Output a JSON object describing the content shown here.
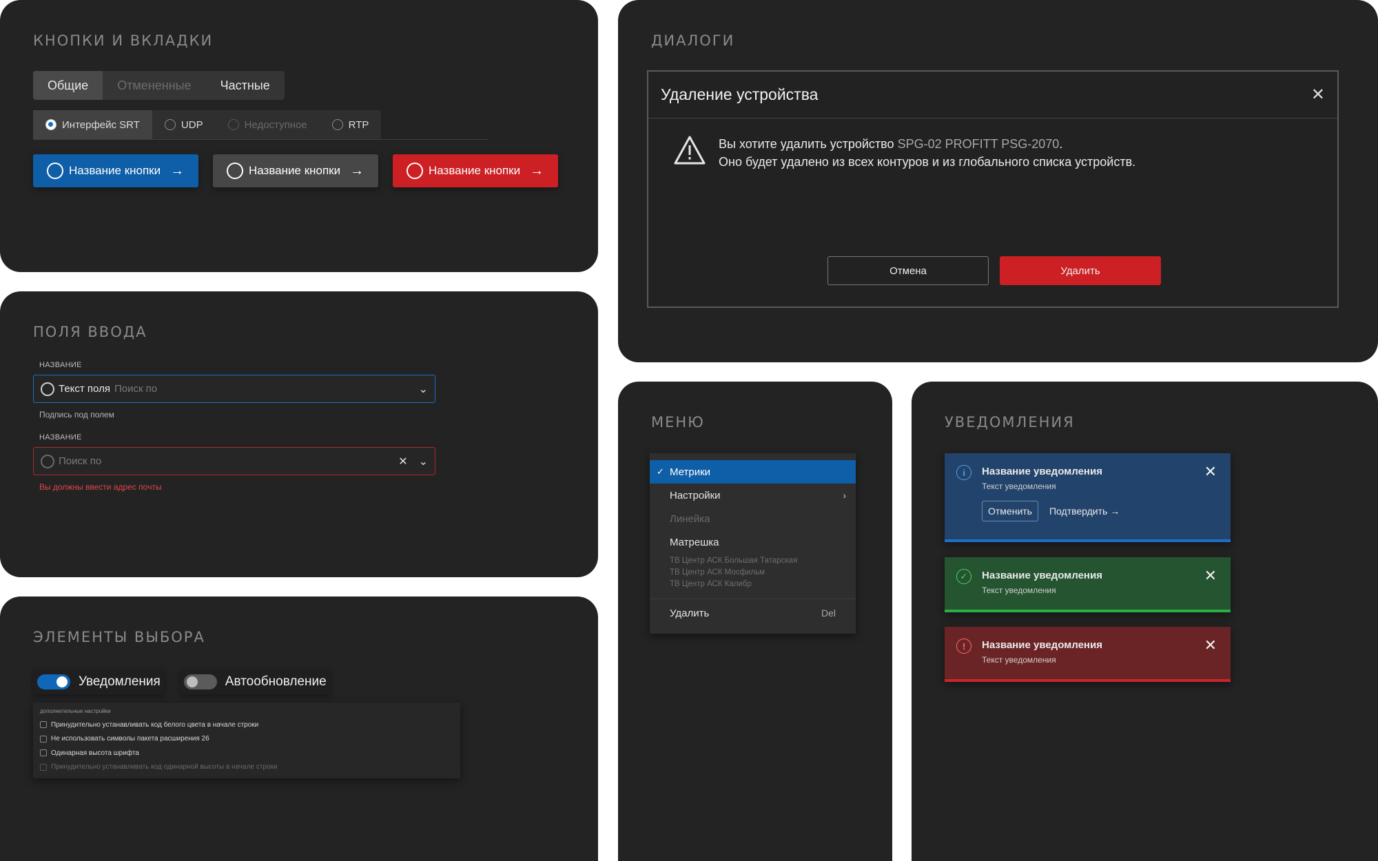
{
  "buttons_panel": {
    "title": "КНОПКИ И ВКЛАДКИ",
    "tabs": [
      {
        "label": "Общие",
        "state": "active"
      },
      {
        "label": "Отмененные",
        "state": "disabled"
      },
      {
        "label": "Частные",
        "state": "normal"
      }
    ],
    "radio_tabs": [
      {
        "label": "Интерфейс SRT",
        "state": "active"
      },
      {
        "label": "UDP",
        "state": "normal"
      },
      {
        "label": "Недоступное",
        "state": "disabled"
      },
      {
        "label": "RTP",
        "state": "normal"
      }
    ],
    "buttons": [
      {
        "label": "Название кнопки",
        "color": "#0e5ea8"
      },
      {
        "label": "Название кнопки",
        "color": "#474747"
      },
      {
        "label": "Название кнопки",
        "color": "#cc2024"
      }
    ]
  },
  "inputs_panel": {
    "title": "ПОЛЯ ВВОДА",
    "field1": {
      "label": "НАЗВАНИЕ",
      "value": "Текст поля",
      "placeholder": "Поиск по",
      "hint": "Подпись под полем"
    },
    "field2": {
      "label": "НАЗВАНИЕ",
      "placeholder": "Поиск по",
      "error": "Вы должны ввести адрес почты"
    }
  },
  "select_panel": {
    "title": "ЭЛЕМЕНТЫ ВЫБОРА",
    "toggles": [
      {
        "label": "Уведомления",
        "on": true
      },
      {
        "label": "Автообновление",
        "on": false
      }
    ],
    "checks_header": "дополнительные настройки",
    "checks": [
      {
        "label": "Принудительно устанавливать код белого цвета в начале строки",
        "disabled": false
      },
      {
        "label": "Не использовать символы пакета расширения 26",
        "disabled": false
      },
      {
        "label": "Одинарная высота шрифта",
        "disabled": false
      },
      {
        "label": "Принудительно устанавливать код одинарной высоты в начале строки",
        "disabled": true
      }
    ]
  },
  "dialogs_panel": {
    "title": "ДИАЛОГИ",
    "dialog": {
      "heading": "Удаление устройства",
      "line1_prefix": "Вы хотите удалить устройство",
      "device": "SPG-02 PROFITT PSG-2070",
      "line1_suffix": ".",
      "line2": "Оно будет удалено из всех контуров и из глобального списка устройств.",
      "cancel": "Отмена",
      "delete": "Удалить"
    }
  },
  "menu_panel": {
    "title": "МЕНЮ",
    "items": {
      "metrics": "Метрики",
      "settings": "Настройки",
      "ruler": "Линейка",
      "matryoshka": "Матрешка",
      "group": [
        "ТВ Центр АСК Большая Татарская",
        "ТВ Центр АСК Мосфильм",
        "ТВ Центр АСК Калибр"
      ],
      "delete": "Удалить",
      "delete_shortcut": "Del"
    }
  },
  "notifications_panel": {
    "title": "УВЕДОМЛЕНИЯ",
    "items": [
      {
        "kind": "info",
        "title": "Название уведомления",
        "text": "Текст уведомления",
        "cancel": "Отменить",
        "confirm": "Подтвердить"
      },
      {
        "kind": "success",
        "title": "Название уведомления",
        "text": "Текст уведомления"
      },
      {
        "kind": "error",
        "title": "Название уведомления",
        "text": "Текст уведомления"
      }
    ]
  }
}
